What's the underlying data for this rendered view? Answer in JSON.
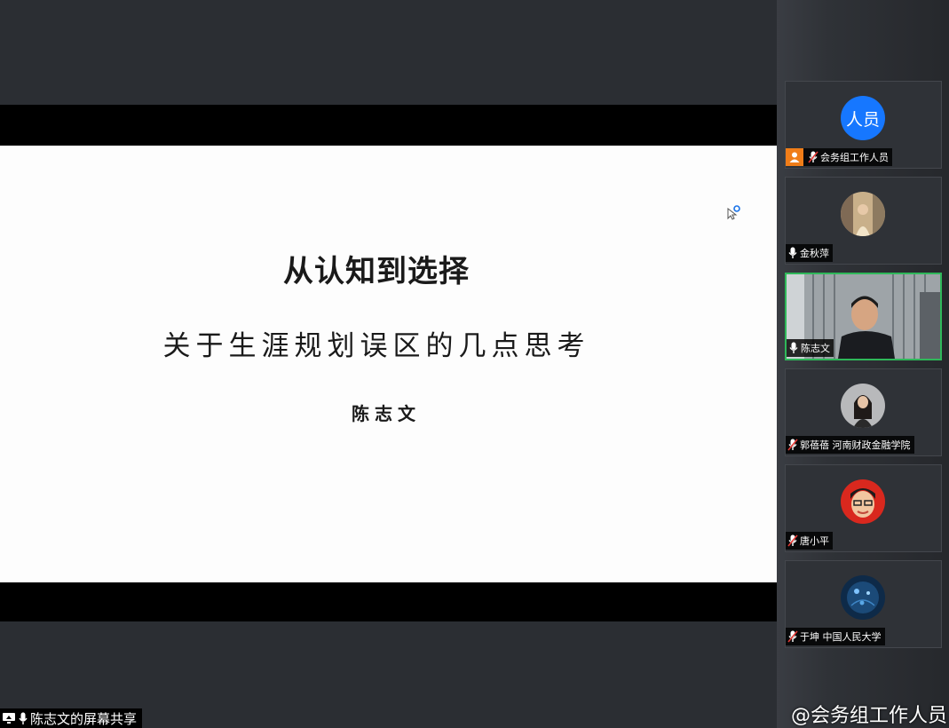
{
  "slide": {
    "title": "从认知到选择",
    "subtitle": "关于生涯规划误区的几点思考",
    "author": "陈志文"
  },
  "screen_share": {
    "label": "陈志文的屏幕共享"
  },
  "participants": [
    {
      "name": "会务组工作人员",
      "avatar_text": "人员",
      "avatar_color": "#1677ff",
      "mic": "muted",
      "host": true
    },
    {
      "name": "金秋萍",
      "mic": "on"
    },
    {
      "name": "陈志文",
      "mic": "on",
      "speaking": true
    },
    {
      "name": "郭蓓蓓 河南财政金融学院",
      "mic": "muted"
    },
    {
      "name": "唐小平",
      "mic": "muted"
    },
    {
      "name": "于坤 中国人民大学",
      "mic": "muted"
    }
  ],
  "watermark": "@会务组工作人员",
  "colors": {
    "active_border": "#2fb85a",
    "host_badge": "#f07d18",
    "muted_mic": "#e53935"
  }
}
